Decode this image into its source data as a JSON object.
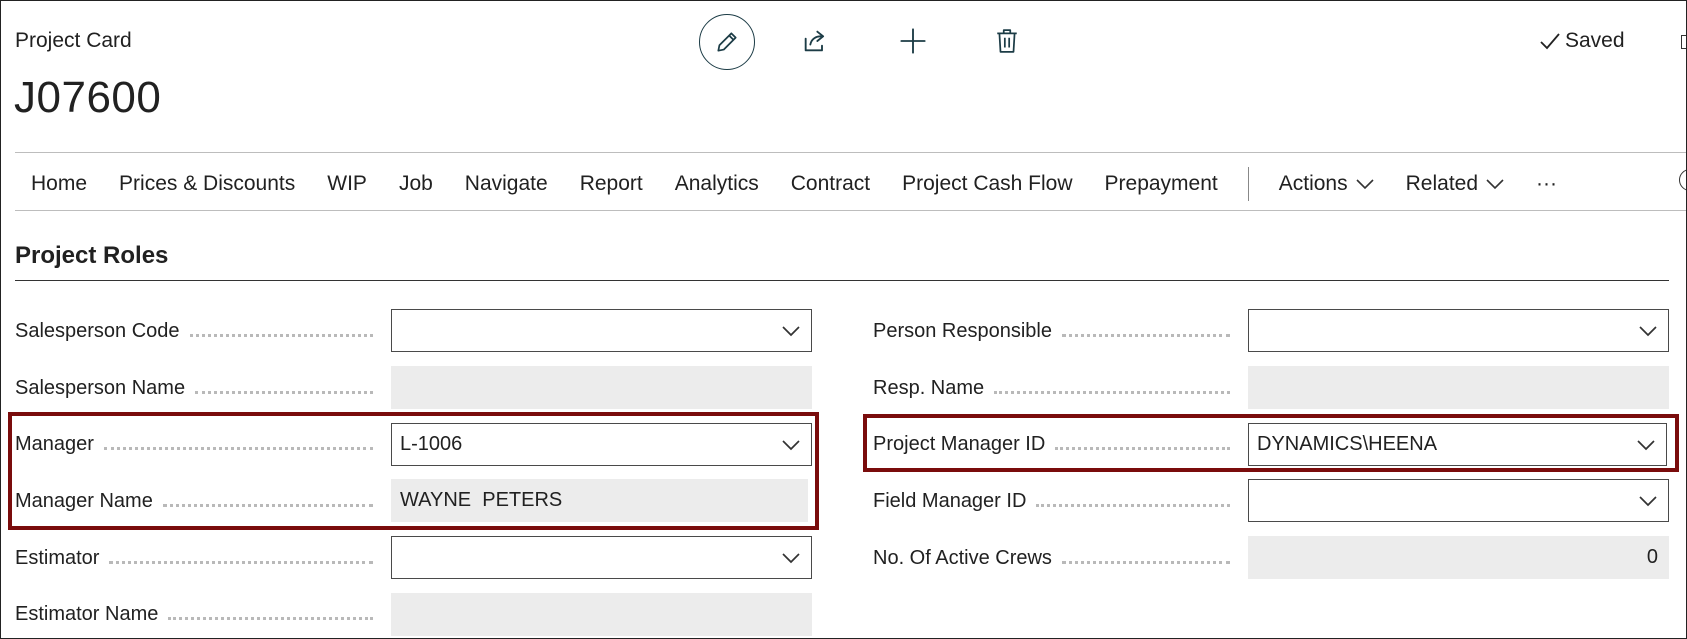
{
  "header": {
    "caption": "Project Card",
    "record_no": "J07600",
    "saved_label": "Saved",
    "actions": {
      "edit": "pencil-icon",
      "share": "share-icon",
      "add": "plus-icon",
      "delete": "trash-icon"
    }
  },
  "nav": {
    "items": [
      "Home",
      "Prices & Discounts",
      "WIP",
      "Job",
      "Navigate",
      "Report",
      "Analytics",
      "Contract",
      "Project Cash Flow",
      "Prepayment"
    ],
    "actions": "Actions",
    "related": "Related",
    "more": "···"
  },
  "section": {
    "title": "Project Roles"
  },
  "left_fields": [
    {
      "label": "Salesperson Code",
      "value": ""
    },
    {
      "label": "Salesperson Name",
      "value": ""
    },
    {
      "label": "Manager",
      "value": "L-1006"
    },
    {
      "label": "Manager Name",
      "value": "WAYNE  PETERS"
    },
    {
      "label": "Estimator",
      "value": ""
    },
    {
      "label": "Estimator Name",
      "value": ""
    }
  ],
  "right_fields": [
    {
      "label": "Person Responsible",
      "value": ""
    },
    {
      "label": "Resp. Name",
      "value": ""
    },
    {
      "label": "Project Manager ID",
      "value": "DYNAMICS\\HEENA"
    },
    {
      "label": "Field Manager ID",
      "value": ""
    },
    {
      "label": "No. Of Active Crews",
      "value": "0"
    }
  ],
  "colors": {
    "highlight": "#7a0c0c",
    "readonly_bg": "#ececec",
    "accent_dark": "#1c3c46"
  }
}
